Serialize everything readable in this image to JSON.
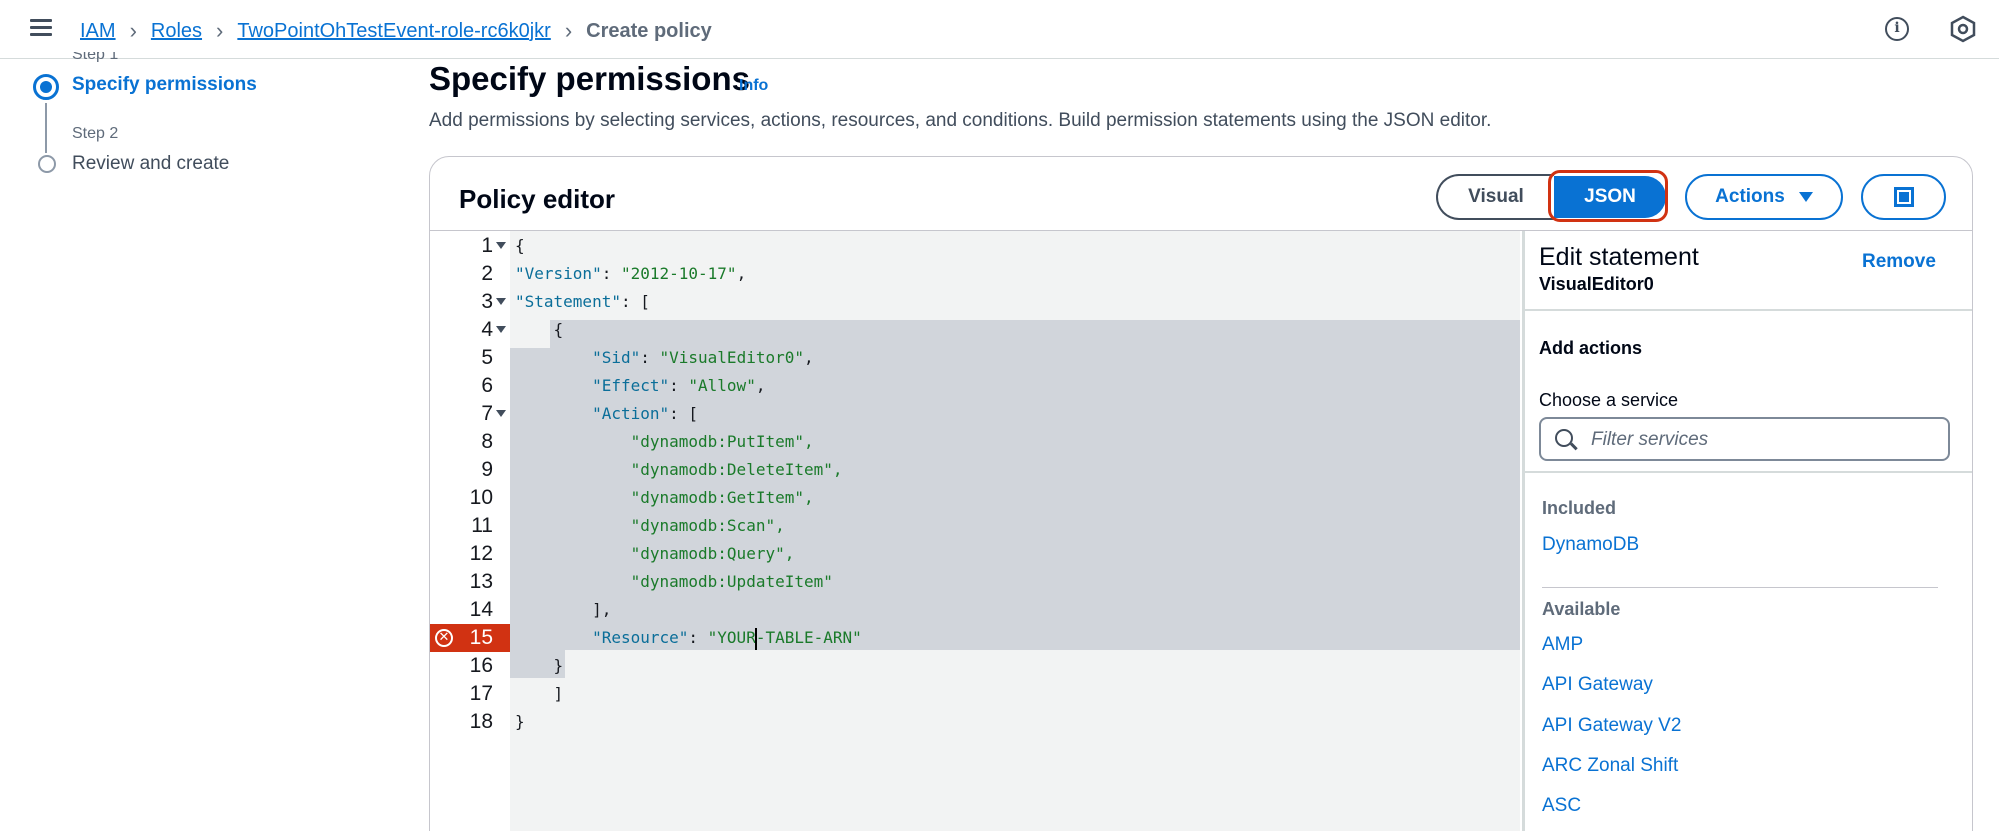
{
  "breadcrumb": {
    "items": [
      "IAM",
      "Roles",
      "TwoPointOhTestEvent-role-rc6k0jkr"
    ],
    "current": "Create policy"
  },
  "steps": [
    {
      "caption": "Step 1",
      "label": "Specify permissions"
    },
    {
      "caption": "Step 2",
      "label": "Review and create"
    }
  ],
  "header": {
    "title": "Specify permissions",
    "info": "Info",
    "description": "Add permissions by selecting services, actions, resources, and conditions. Build permission statements using the JSON editor."
  },
  "editor": {
    "title": "Policy editor",
    "visual_label": "Visual",
    "json_label": "JSON",
    "actions_label": "Actions",
    "error_line": "15",
    "lines": [
      {
        "n": "1",
        "code": "{"
      },
      {
        "n": "2",
        "code": "\"Version\": \"2012-10-17\","
      },
      {
        "n": "3",
        "code": "\"Statement\": ["
      },
      {
        "n": "4",
        "code": "    {"
      },
      {
        "n": "5",
        "code": "        \"Sid\": \"VisualEditor0\","
      },
      {
        "n": "6",
        "code": "        \"Effect\": \"Allow\","
      },
      {
        "n": "7",
        "code": "        \"Action\": ["
      },
      {
        "n": "8",
        "code": "            \"dynamodb:PutItem\","
      },
      {
        "n": "9",
        "code": "            \"dynamodb:DeleteItem\","
      },
      {
        "n": "10",
        "code": "            \"dynamodb:GetItem\","
      },
      {
        "n": "11",
        "code": "            \"dynamodb:Scan\","
      },
      {
        "n": "12",
        "code": "            \"dynamodb:Query\","
      },
      {
        "n": "13",
        "code": "            \"dynamodb:UpdateItem\""
      },
      {
        "n": "14",
        "code": "        ],"
      },
      {
        "n": "15",
        "code": "        \"Resource\": \"YOUR-TABLE-ARN\""
      },
      {
        "n": "16",
        "code": "    }"
      },
      {
        "n": "17",
        "code": "    ]"
      },
      {
        "n": "18",
        "code": "}"
      }
    ]
  },
  "side_panel": {
    "title": "Edit statement",
    "subtitle": "VisualEditor0",
    "remove_label": "Remove",
    "add_actions": "Add actions",
    "choose_service": "Choose a service",
    "filter_placeholder": "Filter services",
    "included_label": "Included",
    "included": [
      "DynamoDB"
    ],
    "available_label": "Available",
    "available": [
      "AMP",
      "API Gateway",
      "API Gateway V2",
      "ARC Zonal Shift",
      "ASC"
    ]
  },
  "colors": {
    "accent": "#0972d3",
    "error": "#d13212",
    "selection": "#d1d5db"
  }
}
